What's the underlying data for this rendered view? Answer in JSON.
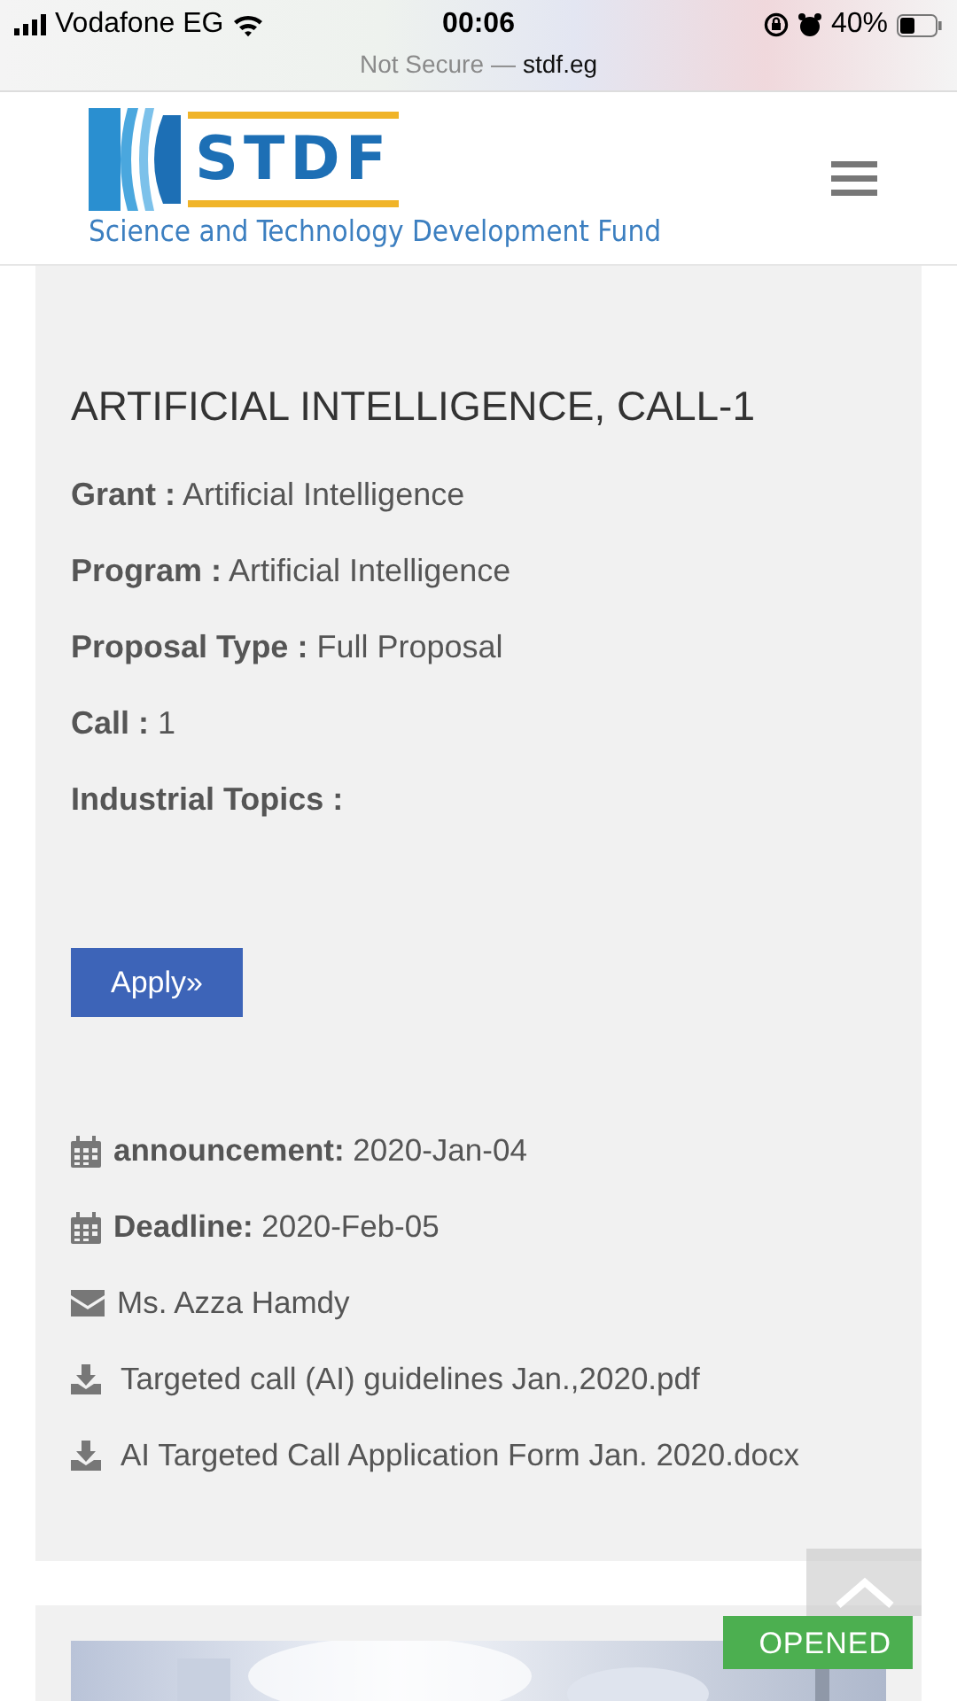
{
  "status_bar": {
    "carrier": "Vodafone EG",
    "time": "00:06",
    "battery": "40%"
  },
  "address_bar": {
    "security": "Not Secure",
    "separator": "—",
    "domain": "stdf.eg"
  },
  "header": {
    "logo_text": "STDF",
    "logo_tagline": "Science and Technology Development Fund"
  },
  "call": {
    "title": "ARTIFICIAL INTELLIGENCE, CALL-1",
    "fields": [
      {
        "label": "Grant :",
        "value": "Artificial Intelligence"
      },
      {
        "label": "Program :",
        "value": "Artificial Intelligence"
      },
      {
        "label": "Proposal Type :",
        "value": "Full Proposal"
      },
      {
        "label": "Call :",
        "value": "1"
      },
      {
        "label": "Industrial Topics :"
      }
    ],
    "apply_button": "Apply»",
    "details": [
      {
        "kind": "date",
        "label": "announcement:",
        "value": "2020-Jan-04"
      },
      {
        "kind": "date",
        "label": "Deadline:",
        "value": "2020-Feb-05"
      },
      {
        "kind": "contact",
        "value": "Ms. Azza Hamdy"
      },
      {
        "kind": "download",
        "value": "Targeted call (AI) guidelines Jan.,2020.pdf"
      },
      {
        "kind": "download",
        "value": "AI Targeted Call Application Form Jan. 2020.docx"
      }
    ]
  },
  "next_card": {
    "badge": "OPENED"
  }
}
